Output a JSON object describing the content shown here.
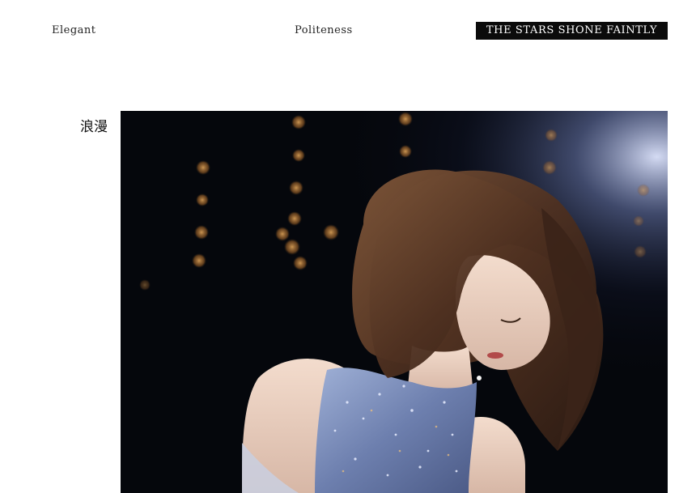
{
  "header": {
    "left_word": "Elegant",
    "center_word": "Politeness",
    "badge_text": "THE STARS SHONE FAINTLY"
  },
  "section": {
    "side_label": "浪漫"
  },
  "photo": {
    "alt": "",
    "accent_colors": {
      "background": "#05070c",
      "bokeh": "#c98a3e",
      "backlight": "#cfd9ff",
      "hair": "#5a3a28",
      "dress": "#7d8fb8"
    }
  }
}
